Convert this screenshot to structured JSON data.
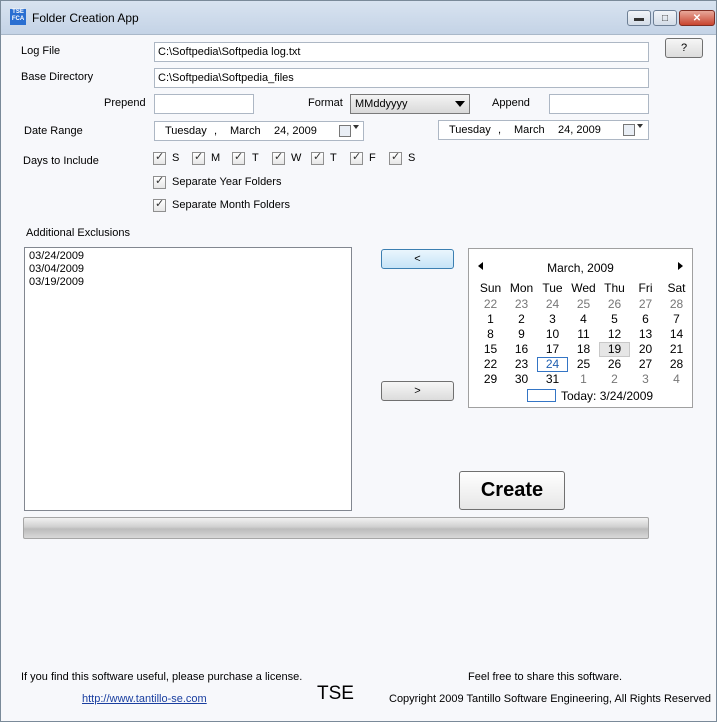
{
  "window": {
    "title": "Folder Creation App",
    "icon_text": "TSE FCA",
    "minimize": "▬",
    "maximize": "□",
    "close": "✕"
  },
  "help_button": "?",
  "fields": {
    "log_file_label": "Log File",
    "log_file_value": "C:\\Softpedia\\Softpedia log.txt",
    "base_dir_label": "Base Directory",
    "base_dir_value": "C:\\Softpedia\\Softpedia_files",
    "prepend_label": "Prepend",
    "prepend_value": "",
    "format_label": "Format",
    "format_value": "MMddyyyy",
    "append_label": "Append",
    "append_value": ""
  },
  "date_range": {
    "label": "Date Range",
    "start": {
      "weekday": "Tuesday",
      "sep": ",",
      "month": "March",
      "date": "24, 2009"
    },
    "end": {
      "weekday": "Tuesday",
      "sep": ",",
      "month": "March",
      "date": "24, 2009"
    }
  },
  "days": {
    "label": "Days to Include",
    "items": [
      "S",
      "M",
      "T",
      "W",
      "T",
      "F",
      "S"
    ],
    "checked": [
      true,
      true,
      true,
      true,
      true,
      true,
      true
    ]
  },
  "options": {
    "year_folders": "Separate Year Folders",
    "month_folders": "Separate Month Folders"
  },
  "exclusions": {
    "label": "Additional Exclusions",
    "items": [
      "03/24/2009",
      "03/04/2009",
      "03/19/2009"
    ]
  },
  "move_left": "<",
  "move_right": ">",
  "calendar": {
    "month_label": "March, 2009",
    "weekdays": [
      "Sun",
      "Mon",
      "Tue",
      "Wed",
      "Thu",
      "Fri",
      "Sat"
    ],
    "weeks": [
      [
        "22",
        "23",
        "24",
        "25",
        "26",
        "27",
        "28"
      ],
      [
        "1",
        "2",
        "3",
        "4",
        "5",
        "6",
        "7"
      ],
      [
        "8",
        "9",
        "10",
        "11",
        "12",
        "13",
        "14"
      ],
      [
        "15",
        "16",
        "17",
        "18",
        "19",
        "20",
        "21"
      ],
      [
        "22",
        "23",
        "24",
        "25",
        "26",
        "27",
        "28"
      ],
      [
        "29",
        "30",
        "31",
        "1",
        "2",
        "3",
        "4"
      ]
    ],
    "today_label": "Today: 3/24/2009"
  },
  "create_button": "Create",
  "progress": {
    "value": 0
  },
  "footer": {
    "purchase_text": "If you find this software useful, please purchase a license.",
    "url": "http://www.tantillo-se.com",
    "tse": "TSE",
    "share_text": "Feel free to share this software.",
    "copyright": "Copyright 2009 Tantillo Software Engineering, All Rights Reserved"
  }
}
